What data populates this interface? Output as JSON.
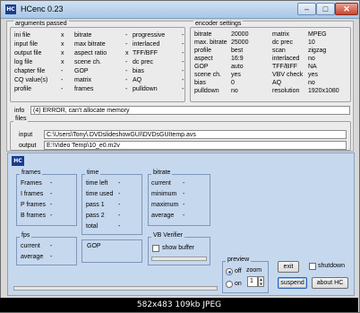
{
  "window": {
    "title": "HCenc 0.23",
    "icon": "HC"
  },
  "args": {
    "title": "arguments passed",
    "col1": [
      {
        "label": "ini file",
        "value": "x"
      },
      {
        "label": "input file",
        "value": "x"
      },
      {
        "label": "output file",
        "value": "x"
      },
      {
        "label": "log file",
        "value": "x"
      },
      {
        "label": "chapter file",
        "value": "-"
      },
      {
        "label": "CQ value(s)",
        "value": "-"
      },
      {
        "label": "profile",
        "value": "-"
      }
    ],
    "col2": [
      {
        "label": "bitrate",
        "value": "-"
      },
      {
        "label": "max bitrate",
        "value": "-"
      },
      {
        "label": "aspect ratio",
        "value": "x"
      },
      {
        "label": "scene ch.",
        "value": "-"
      },
      {
        "label": "GOP",
        "value": "-"
      },
      {
        "label": "matrix",
        "value": "-"
      },
      {
        "label": "frames",
        "value": "-"
      }
    ],
    "col3": [
      {
        "label": "progressive",
        "value": "-"
      },
      {
        "label": "interlaced",
        "value": "-"
      },
      {
        "label": "TFF/BFF",
        "value": "-"
      },
      {
        "label": "dc prec",
        "value": "-"
      },
      {
        "label": "bias",
        "value": "-"
      },
      {
        "label": "AQ",
        "value": "-"
      },
      {
        "label": "pulldown",
        "value": "-"
      }
    ]
  },
  "encoder": {
    "title": "encoder settings",
    "col1": [
      {
        "label": "bitrate",
        "value": "20000"
      },
      {
        "label": "max. bitrate",
        "value": "25000"
      },
      {
        "label": "profile",
        "value": "best"
      },
      {
        "label": "aspect",
        "value": "16:9"
      },
      {
        "label": "GOP",
        "value": "auto"
      },
      {
        "label": "scene ch.",
        "value": "yes"
      },
      {
        "label": "bias",
        "value": "0"
      },
      {
        "label": "pulldown",
        "value": "no"
      }
    ],
    "col2": [
      {
        "label": "matrix",
        "value": "MPEG"
      },
      {
        "label": "dc prec",
        "value": "10"
      },
      {
        "label": "scan",
        "value": "zigzag"
      },
      {
        "label": "interlaced",
        "value": "no"
      },
      {
        "label": "TFF/BFF",
        "value": "NA"
      },
      {
        "label": "VBV check",
        "value": "yes"
      },
      {
        "label": "AQ",
        "value": "no"
      },
      {
        "label": "resolution",
        "value": "1920x1080"
      }
    ]
  },
  "info": {
    "label": "info",
    "value": "(4) ERROR, can't allocate memory"
  },
  "files": {
    "title": "files",
    "input_label": "input",
    "input_value": "C:\\Users\\Tony\\.DVDslideshowGUI\\DVDsGUItemp.avs",
    "output_label": "output",
    "output_value": "E:\\Video Temp\\10_e0.m2v"
  },
  "frames": {
    "title": "frames",
    "rows": [
      {
        "label": "Frames",
        "value": "-"
      },
      {
        "label": "I frames",
        "value": "-"
      },
      {
        "label": "P frames",
        "value": "-"
      },
      {
        "label": "B frames",
        "value": "-"
      }
    ]
  },
  "time": {
    "title": "time",
    "rows": [
      {
        "label": "time left",
        "value": "-"
      },
      {
        "label": "time used",
        "value": "-"
      },
      {
        "label": "pass 1",
        "value": "-"
      },
      {
        "label": "pass 2",
        "value": "-"
      },
      {
        "label": "total",
        "value": "-"
      }
    ]
  },
  "bitrate": {
    "title": "bitrate",
    "rows": [
      {
        "label": "current",
        "value": "-"
      },
      {
        "label": "minimum",
        "value": "-"
      },
      {
        "label": "maximum",
        "value": "-"
      },
      {
        "label": "average",
        "value": "-"
      }
    ]
  },
  "fps": {
    "title": "fps",
    "rows": [
      {
        "label": "current",
        "value": "-"
      },
      {
        "label": "average",
        "value": "-"
      }
    ]
  },
  "gop": {
    "label": "GOP"
  },
  "vb": {
    "title": "VB Verifier",
    "show_buffer": "show buffer",
    "show_buffer_checked": false
  },
  "preview": {
    "title": "preview",
    "off": "off",
    "on": "on",
    "off_selected": true,
    "zoom_label": "zoom",
    "zoom_value": "1"
  },
  "buttons": {
    "exit": "exit",
    "shutdown": "shutdown",
    "suspend": "suspend",
    "about": "about HC"
  },
  "statusbar": "582x483  109kb  JPEG"
}
